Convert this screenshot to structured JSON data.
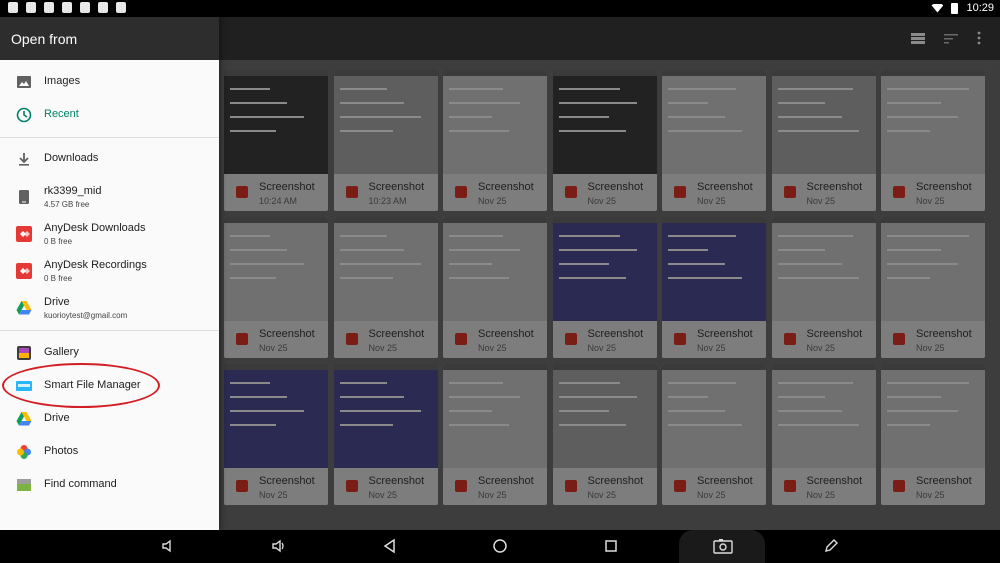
{
  "status": {
    "time": "10:29"
  },
  "drawer": {
    "title": "Open from",
    "items": [
      {
        "label": "Images"
      },
      {
        "label": "Recent"
      },
      {
        "label": "Downloads"
      },
      {
        "label": "rk3399_mid",
        "sub": "4.57 GB free"
      },
      {
        "label": "AnyDesk Downloads",
        "sub": "0 B free"
      },
      {
        "label": "AnyDesk Recordings",
        "sub": "0 B free"
      },
      {
        "label": "Drive",
        "sub": "kuorioytest@gmail.com"
      },
      {
        "label": "Gallery"
      },
      {
        "label": "Smart File Manager"
      },
      {
        "label": "Drive"
      },
      {
        "label": "Photos"
      },
      {
        "label": "Find command"
      }
    ]
  },
  "files": {
    "rows": [
      [
        {
          "name": "Screenshot",
          "date": "10:24 AM",
          "thumb": "dark"
        },
        {
          "name": "Screenshot",
          "date": "10:23 AM",
          "thumb": "grey"
        },
        {
          "name": "Screenshot",
          "date": "Nov 25",
          "thumb": "light"
        },
        {
          "name": "Screenshot",
          "date": "Nov 25",
          "thumb": "dark"
        },
        {
          "name": "Screenshot",
          "date": "Nov 25",
          "thumb": "light"
        },
        {
          "name": "Screenshot",
          "date": "Nov 25",
          "thumb": "grey"
        },
        {
          "name": "Screenshot",
          "date": "Nov 25",
          "thumb": "light"
        }
      ],
      [
        {
          "name": "Screenshot",
          "date": "Nov 25",
          "thumb": "light"
        },
        {
          "name": "Screenshot",
          "date": "Nov 25",
          "thumb": "light"
        },
        {
          "name": "Screenshot",
          "date": "Nov 25",
          "thumb": "light"
        },
        {
          "name": "Screenshot",
          "date": "Nov 25",
          "thumb": "blue"
        },
        {
          "name": "Screenshot",
          "date": "Nov 25",
          "thumb": "blue"
        },
        {
          "name": "Screenshot",
          "date": "Nov 25",
          "thumb": "light"
        },
        {
          "name": "Screenshot",
          "date": "Nov 25",
          "thumb": "light"
        }
      ],
      [
        {
          "name": "Screenshot",
          "date": "Nov 25",
          "thumb": "blue"
        },
        {
          "name": "Screenshot",
          "date": "Nov 25",
          "thumb": "blue"
        },
        {
          "name": "Screenshot",
          "date": "Nov 25",
          "thumb": "light"
        },
        {
          "name": "Screenshot",
          "date": "Nov 25",
          "thumb": "grey"
        },
        {
          "name": "Screenshot",
          "date": "Nov 25",
          "thumb": "light"
        },
        {
          "name": "Screenshot",
          "date": "Nov 25",
          "thumb": "light"
        },
        {
          "name": "Screenshot",
          "date": "Nov 25",
          "thumb": "light"
        }
      ]
    ]
  }
}
